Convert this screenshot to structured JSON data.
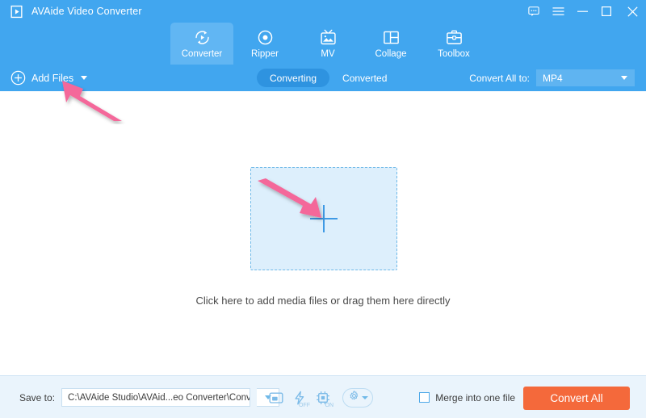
{
  "window": {
    "app_title": "AVAide Video Converter",
    "logo_icon": "play-logo-icon",
    "controls": [
      {
        "name": "feedback-icon",
        "glyph": "speech-bubble"
      },
      {
        "name": "menu-icon",
        "glyph": "hamburger"
      },
      {
        "name": "minimize-icon",
        "glyph": "minus"
      },
      {
        "name": "maximize-icon",
        "glyph": "square"
      },
      {
        "name": "close-icon",
        "glyph": "cross"
      }
    ]
  },
  "nav": {
    "tabs": [
      {
        "label": "Converter",
        "icon": "convert-circle-icon",
        "active": true
      },
      {
        "label": "Ripper",
        "icon": "disc-icon",
        "active": false
      },
      {
        "label": "MV",
        "icon": "tv-photo-icon",
        "active": false
      },
      {
        "label": "Collage",
        "icon": "grid-layout-icon",
        "active": false
      },
      {
        "label": "Toolbox",
        "icon": "toolbox-icon",
        "active": false
      }
    ]
  },
  "toolbar": {
    "add_files_label": "Add Files",
    "add_files_icon": "plus-circle-icon",
    "segments": [
      {
        "label": "Converting",
        "active": true
      },
      {
        "label": "Converted",
        "active": false
      }
    ],
    "convert_all_to_label": "Convert All to:",
    "output_format": "MP4",
    "format_options": [
      "MP4"
    ]
  },
  "main": {
    "dropzone_icon": "plus-crosshair-icon",
    "drop_hint": "Click here to add media files or drag them here directly"
  },
  "bottom": {
    "save_to_label": "Save to:",
    "save_to_path": "C:\\AVAide Studio\\AVAid...eo Converter\\Converted",
    "tools": [
      {
        "name": "open-folder-icon",
        "state": ""
      },
      {
        "name": "hardware-acceleration-icon",
        "state": "OFF"
      },
      {
        "name": "gpu-chip-icon",
        "state": "ON"
      }
    ],
    "preferences_icon": "gear-icon",
    "merge_label": "Merge into one file",
    "merge_checked": false,
    "convert_all_label": "Convert All"
  },
  "annotations": [
    {
      "name": "arrow-to-add-files",
      "target": "Add Files"
    },
    {
      "name": "arrow-to-dropzone-plus",
      "target": "dropzone plus"
    }
  ],
  "colors": {
    "brand_blue": "#41a6ef",
    "accent_orange": "#f4693b",
    "annotation_pink": "#f4679a",
    "dropzone_fill": "#ddeffc",
    "bottom_bar": "#eaf4fc"
  }
}
